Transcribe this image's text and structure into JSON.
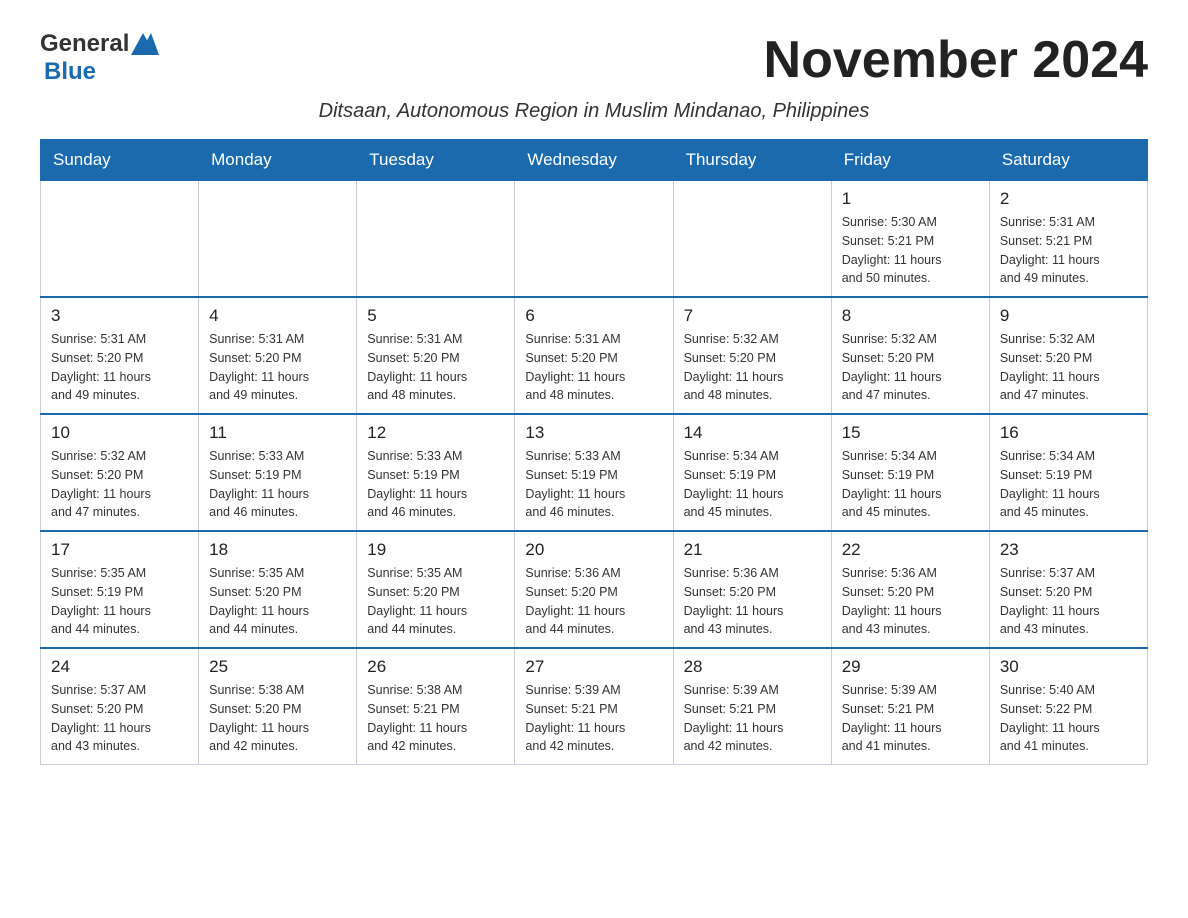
{
  "header": {
    "logo_general": "General",
    "logo_blue": "Blue",
    "title": "November 2024",
    "subtitle": "Ditsaan, Autonomous Region in Muslim Mindanao, Philippines"
  },
  "calendar": {
    "days_of_week": [
      "Sunday",
      "Monday",
      "Tuesday",
      "Wednesday",
      "Thursday",
      "Friday",
      "Saturday"
    ],
    "weeks": [
      {
        "cells": [
          {
            "day": null,
            "info": null
          },
          {
            "day": null,
            "info": null
          },
          {
            "day": null,
            "info": null
          },
          {
            "day": null,
            "info": null
          },
          {
            "day": null,
            "info": null
          },
          {
            "day": "1",
            "info": "Sunrise: 5:30 AM\nSunset: 5:21 PM\nDaylight: 11 hours\nand 50 minutes."
          },
          {
            "day": "2",
            "info": "Sunrise: 5:31 AM\nSunset: 5:21 PM\nDaylight: 11 hours\nand 49 minutes."
          }
        ]
      },
      {
        "cells": [
          {
            "day": "3",
            "info": "Sunrise: 5:31 AM\nSunset: 5:20 PM\nDaylight: 11 hours\nand 49 minutes."
          },
          {
            "day": "4",
            "info": "Sunrise: 5:31 AM\nSunset: 5:20 PM\nDaylight: 11 hours\nand 49 minutes."
          },
          {
            "day": "5",
            "info": "Sunrise: 5:31 AM\nSunset: 5:20 PM\nDaylight: 11 hours\nand 48 minutes."
          },
          {
            "day": "6",
            "info": "Sunrise: 5:31 AM\nSunset: 5:20 PM\nDaylight: 11 hours\nand 48 minutes."
          },
          {
            "day": "7",
            "info": "Sunrise: 5:32 AM\nSunset: 5:20 PM\nDaylight: 11 hours\nand 48 minutes."
          },
          {
            "day": "8",
            "info": "Sunrise: 5:32 AM\nSunset: 5:20 PM\nDaylight: 11 hours\nand 47 minutes."
          },
          {
            "day": "9",
            "info": "Sunrise: 5:32 AM\nSunset: 5:20 PM\nDaylight: 11 hours\nand 47 minutes."
          }
        ]
      },
      {
        "cells": [
          {
            "day": "10",
            "info": "Sunrise: 5:32 AM\nSunset: 5:20 PM\nDaylight: 11 hours\nand 47 minutes."
          },
          {
            "day": "11",
            "info": "Sunrise: 5:33 AM\nSunset: 5:19 PM\nDaylight: 11 hours\nand 46 minutes."
          },
          {
            "day": "12",
            "info": "Sunrise: 5:33 AM\nSunset: 5:19 PM\nDaylight: 11 hours\nand 46 minutes."
          },
          {
            "day": "13",
            "info": "Sunrise: 5:33 AM\nSunset: 5:19 PM\nDaylight: 11 hours\nand 46 minutes."
          },
          {
            "day": "14",
            "info": "Sunrise: 5:34 AM\nSunset: 5:19 PM\nDaylight: 11 hours\nand 45 minutes."
          },
          {
            "day": "15",
            "info": "Sunrise: 5:34 AM\nSunset: 5:19 PM\nDaylight: 11 hours\nand 45 minutes."
          },
          {
            "day": "16",
            "info": "Sunrise: 5:34 AM\nSunset: 5:19 PM\nDaylight: 11 hours\nand 45 minutes."
          }
        ]
      },
      {
        "cells": [
          {
            "day": "17",
            "info": "Sunrise: 5:35 AM\nSunset: 5:19 PM\nDaylight: 11 hours\nand 44 minutes."
          },
          {
            "day": "18",
            "info": "Sunrise: 5:35 AM\nSunset: 5:20 PM\nDaylight: 11 hours\nand 44 minutes."
          },
          {
            "day": "19",
            "info": "Sunrise: 5:35 AM\nSunset: 5:20 PM\nDaylight: 11 hours\nand 44 minutes."
          },
          {
            "day": "20",
            "info": "Sunrise: 5:36 AM\nSunset: 5:20 PM\nDaylight: 11 hours\nand 44 minutes."
          },
          {
            "day": "21",
            "info": "Sunrise: 5:36 AM\nSunset: 5:20 PM\nDaylight: 11 hours\nand 43 minutes."
          },
          {
            "day": "22",
            "info": "Sunrise: 5:36 AM\nSunset: 5:20 PM\nDaylight: 11 hours\nand 43 minutes."
          },
          {
            "day": "23",
            "info": "Sunrise: 5:37 AM\nSunset: 5:20 PM\nDaylight: 11 hours\nand 43 minutes."
          }
        ]
      },
      {
        "cells": [
          {
            "day": "24",
            "info": "Sunrise: 5:37 AM\nSunset: 5:20 PM\nDaylight: 11 hours\nand 43 minutes."
          },
          {
            "day": "25",
            "info": "Sunrise: 5:38 AM\nSunset: 5:20 PM\nDaylight: 11 hours\nand 42 minutes."
          },
          {
            "day": "26",
            "info": "Sunrise: 5:38 AM\nSunset: 5:21 PM\nDaylight: 11 hours\nand 42 minutes."
          },
          {
            "day": "27",
            "info": "Sunrise: 5:39 AM\nSunset: 5:21 PM\nDaylight: 11 hours\nand 42 minutes."
          },
          {
            "day": "28",
            "info": "Sunrise: 5:39 AM\nSunset: 5:21 PM\nDaylight: 11 hours\nand 42 minutes."
          },
          {
            "day": "29",
            "info": "Sunrise: 5:39 AM\nSunset: 5:21 PM\nDaylight: 11 hours\nand 41 minutes."
          },
          {
            "day": "30",
            "info": "Sunrise: 5:40 AM\nSunset: 5:22 PM\nDaylight: 11 hours\nand 41 minutes."
          }
        ]
      }
    ]
  }
}
